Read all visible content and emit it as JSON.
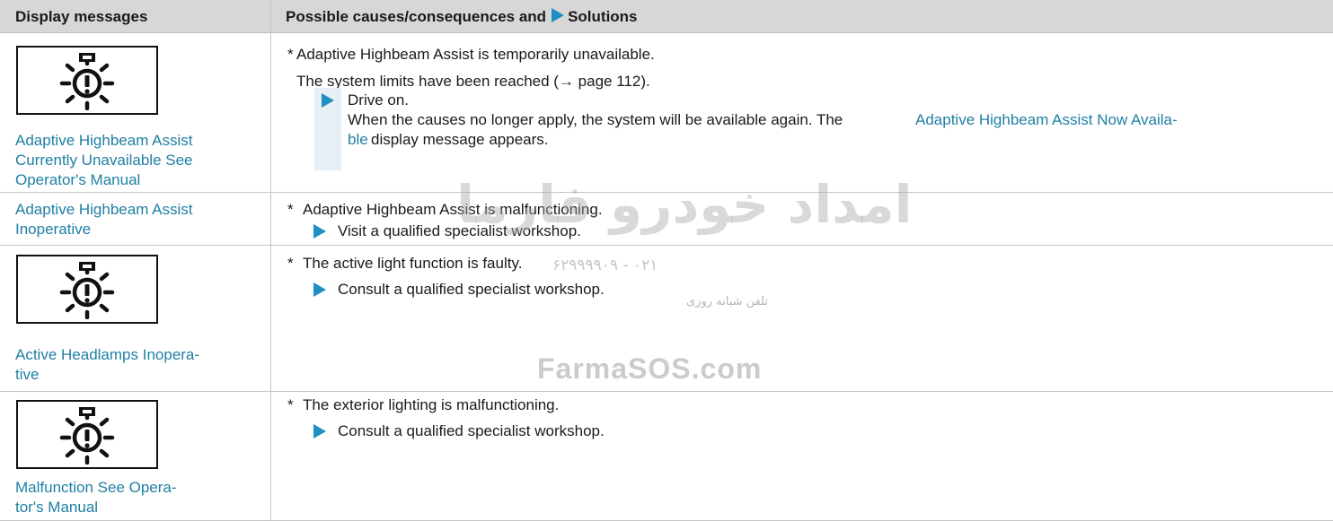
{
  "header": {
    "col1": "Display messages",
    "col2_prefix": "Possible causes/consequences and",
    "col2_suffix": "Solutions"
  },
  "icons": {
    "warning_lamp": "headlamp-warning-icon",
    "solution_arrow": "triangle-right-icon"
  },
  "rows": [
    {
      "message": "Adaptive Highbeam Assist Currently Unavailable See Operator's Manual",
      "has_icon": true,
      "cause_star": "*",
      "cause": "Adaptive Highbeam Assist is temporarily unavailable.",
      "cause_line2": "The system limits have been reached (→ page 112).",
      "solution": "Drive on.",
      "solution_line2_a": "When the causes no longer apply, the system will be available again. The",
      "solution_link_a": "Adaptive Highbeam Assist Now Availa-",
      "solution_link_b": "ble",
      "solution_line3_b": "display message appears."
    },
    {
      "message": "Adaptive Highbeam Assist Inoperative",
      "has_icon": false,
      "cause_star": "*",
      "cause": "Adaptive Highbeam Assist is malfunctioning.",
      "solution": "Visit a qualified specialist workshop."
    },
    {
      "message": "Active Headlamps Inopera-tive",
      "message_line1": "Active Headlamps Inopera-",
      "message_line2": "tive",
      "has_icon": true,
      "cause_star": "*",
      "cause": "The active light function is faulty.",
      "solution": "Consult a qualified specialist workshop."
    },
    {
      "message": "Malfunction See Opera-tor's Manual",
      "message_line1": "Malfunction See Opera-",
      "message_line2": "tor's Manual",
      "has_icon": true,
      "cause_star": "*",
      "cause": "The exterior lighting is malfunctioning.",
      "solution": "Consult a qualified specialist workshop."
    }
  ],
  "watermark": {
    "arabic": "امداد خودرو فارما",
    "phone": "۰۲۱ - ۶۲۹۹۹۹۰۹",
    "phone_tag": "تلفن شبانه روزی",
    "site": "FarmaSOS.com"
  },
  "colors": {
    "link_blue": "#1f7fa4",
    "solution_bar": "#e7eff4",
    "header_bg": "#d7d7d7"
  }
}
